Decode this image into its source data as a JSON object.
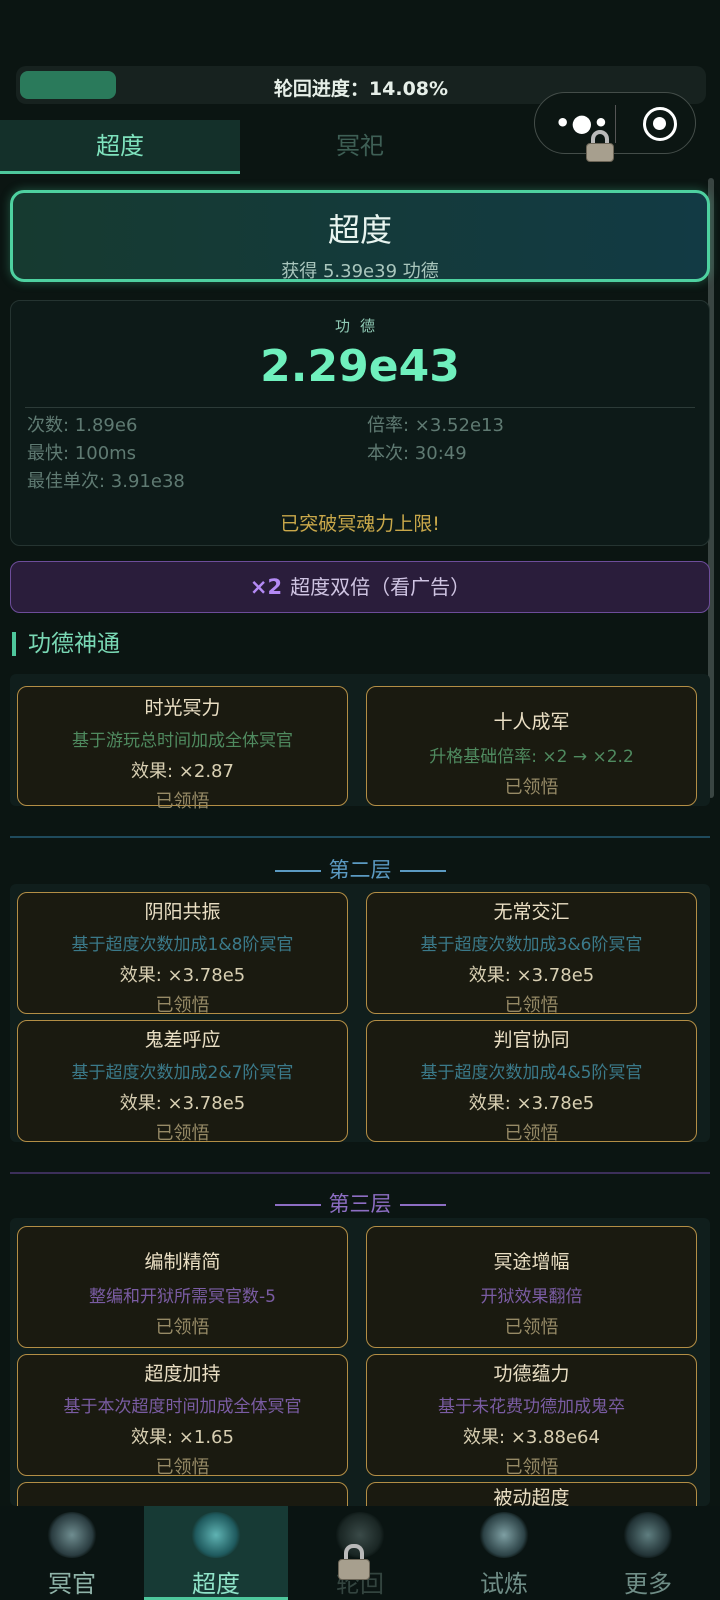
{
  "progress": {
    "label": "轮回进度：14.08%",
    "fraction": 0.1408
  },
  "capsule": {
    "more": "•●•"
  },
  "tabs": [
    {
      "label": "超度"
    },
    {
      "label": "冥祀"
    }
  ],
  "chaodu_button": {
    "title": "超度",
    "subtitle": "获得 5.39e39 功德"
  },
  "merit": {
    "label": "功德",
    "value": "2.29e43",
    "count": "次数: 1.89e6",
    "rate": "倍率: ×3.52e13",
    "fastest": "最快: 100ms",
    "current": "本次: 30:49",
    "best": "最佳单次: 3.91e38",
    "note": "已突破冥魂力上限!"
  },
  "double": {
    "badge": "×2",
    "label": "超度双倍（看广告）"
  },
  "section_title": "功德神通",
  "tier1": [
    {
      "name": "时光冥力",
      "desc": "基于游玩总时间加成全体冥官",
      "effect": "效果: ×2.87",
      "status": "已领悟"
    },
    {
      "name": "十人成军",
      "desc": "升格基础倍率: ×2 → ×2.2",
      "status": "已领悟"
    }
  ],
  "layer2": {
    "title": "第二层"
  },
  "tier2": [
    {
      "name": "阴阳共振",
      "desc": "基于超度次数加成1&8阶冥官",
      "effect": "效果: ×3.78e5",
      "status": "已领悟"
    },
    {
      "name": "无常交汇",
      "desc": "基于超度次数加成3&6阶冥官",
      "effect": "效果: ×3.78e5",
      "status": "已领悟"
    },
    {
      "name": "鬼差呼应",
      "desc": "基于超度次数加成2&7阶冥官",
      "effect": "效果: ×3.78e5",
      "status": "已领悟"
    },
    {
      "name": "判官协同",
      "desc": "基于超度次数加成4&5阶冥官",
      "effect": "效果: ×3.78e5",
      "status": "已领悟"
    }
  ],
  "layer3": {
    "title": "第三层"
  },
  "tier3": [
    {
      "name": "编制精简",
      "desc": "整编和开狱所需冥官数-5",
      "status": "已领悟"
    },
    {
      "name": "冥途增幅",
      "desc": "开狱效果翻倍",
      "status": "已领悟"
    },
    {
      "name": "超度加持",
      "desc": "基于本次超度时间加成全体冥官",
      "effect": "效果: ×1.65",
      "status": "已领悟"
    },
    {
      "name": "功德蕴力",
      "desc": "基于未花费功德加成鬼卒",
      "effect": "效果: ×3.88e64",
      "status": "已领悟"
    },
    {
      "name": "被动超度"
    }
  ],
  "nav": [
    {
      "label": "冥官",
      "icon": "ghost-mask-icon"
    },
    {
      "label": "超度",
      "icon": "temple-icon"
    },
    {
      "label": "轮回",
      "icon": "wheel-icon"
    },
    {
      "label": "试炼",
      "icon": "flame-lotus-icon"
    },
    {
      "label": "更多",
      "icon": "spade-emblem-icon"
    }
  ]
}
